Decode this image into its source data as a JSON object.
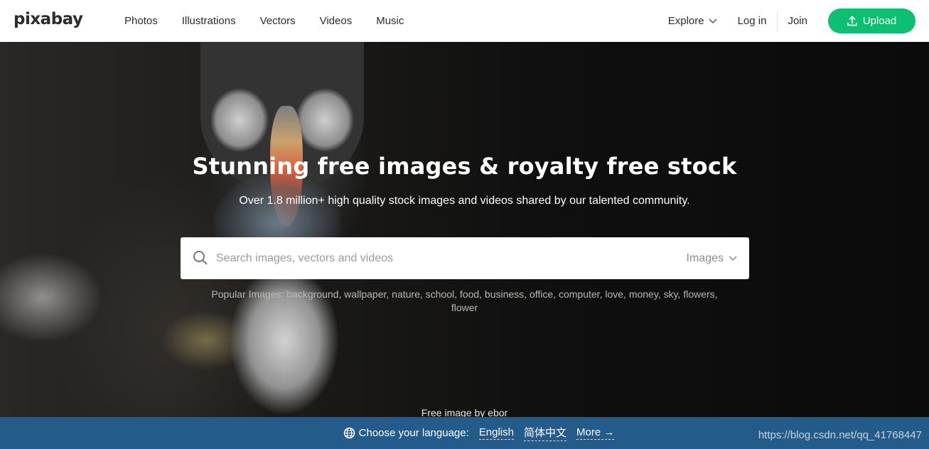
{
  "header": {
    "logo": "pixabay",
    "nav": [
      "Photos",
      "Illustrations",
      "Vectors",
      "Videos",
      "Music"
    ],
    "explore": "Explore",
    "login": "Log in",
    "join": "Join",
    "upload": "Upload",
    "brand_color": "#0dbf70"
  },
  "hero": {
    "title": "Stunning free images & royalty free stock",
    "subtitle": "Over 1.8 million+ high quality stock images and videos shared by our talented community.",
    "search": {
      "placeholder": "Search images, vectors and videos",
      "value": "",
      "type_selected": "Images"
    },
    "popular_label": "Popular Images:",
    "popular_tags": [
      "background",
      "wallpaper",
      "nature",
      "school",
      "food",
      "business",
      "office",
      "computer",
      "love",
      "money",
      "sky",
      "flowers",
      "flower"
    ],
    "credit": "Free image by ebor"
  },
  "language_bar": {
    "label": "Choose your language:",
    "options": [
      "English",
      "简体中文"
    ],
    "more": "More →",
    "background": "#235b8b"
  },
  "watermark": "https://blog.csdn.net/qq_41768447"
}
